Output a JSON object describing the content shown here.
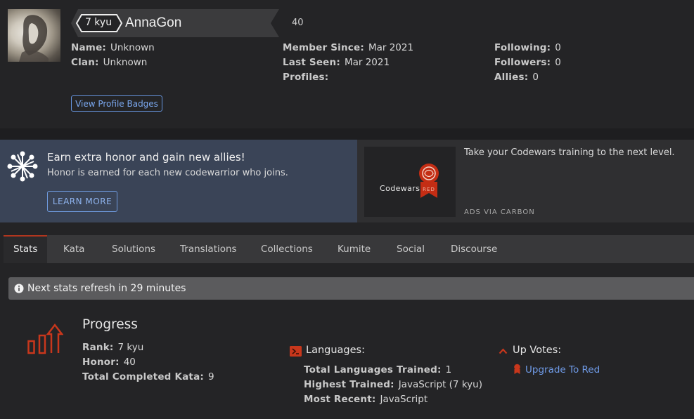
{
  "profile": {
    "rank": "7 kyu",
    "username": "AnnaGon",
    "honor": "40",
    "name_label": "Name:",
    "name_value": "Unknown",
    "clan_label": "Clan:",
    "clan_value": "Unknown",
    "member_since_label": "Member Since:",
    "member_since_value": "Mar 2021",
    "last_seen_label": "Last Seen:",
    "last_seen_value": "Mar 2021",
    "profiles_label": "Profiles:",
    "following_label": "Following:",
    "following_value": "0",
    "followers_label": "Followers:",
    "followers_value": "0",
    "allies_label": "Allies:",
    "allies_value": "0",
    "badges_button": "View Profile Badges"
  },
  "promo": {
    "title": "Earn extra honor and gain new allies!",
    "subtitle": "Honor is earned for each new codewarrior who joins.",
    "button": "LEARN MORE"
  },
  "ad": {
    "brand": "Codewars",
    "badge_text": "RED",
    "text": "Take your Codewars training to the next level.",
    "via": "ADS VIA CARBON"
  },
  "tabs": [
    {
      "label": "Stats",
      "active": true
    },
    {
      "label": "Kata"
    },
    {
      "label": "Solutions"
    },
    {
      "label": "Translations"
    },
    {
      "label": "Collections"
    },
    {
      "label": "Kumite"
    },
    {
      "label": "Social"
    },
    {
      "label": "Discourse"
    }
  ],
  "notice": "Next stats refresh in 29 minutes",
  "progress": {
    "title": "Progress",
    "rank_label": "Rank:",
    "rank_value": "7 kyu",
    "honor_label": "Honor:",
    "honor_value": "40",
    "kata_label": "Total Completed Kata:",
    "kata_value": "9"
  },
  "languages": {
    "title": "Languages:",
    "total_label": "Total Languages Trained:",
    "total_value": "1",
    "highest_label": "Highest Trained:",
    "highest_value": "JavaScript (7 kyu)",
    "recent_label": "Most Recent:",
    "recent_value": "JavaScript"
  },
  "upvotes": {
    "title": "Up Votes:",
    "link": "Upgrade To Red"
  },
  "colors": {
    "accent_red": "#b1361e",
    "link_blue": "#6f9ae6",
    "promo_bg": "#3a4457"
  }
}
